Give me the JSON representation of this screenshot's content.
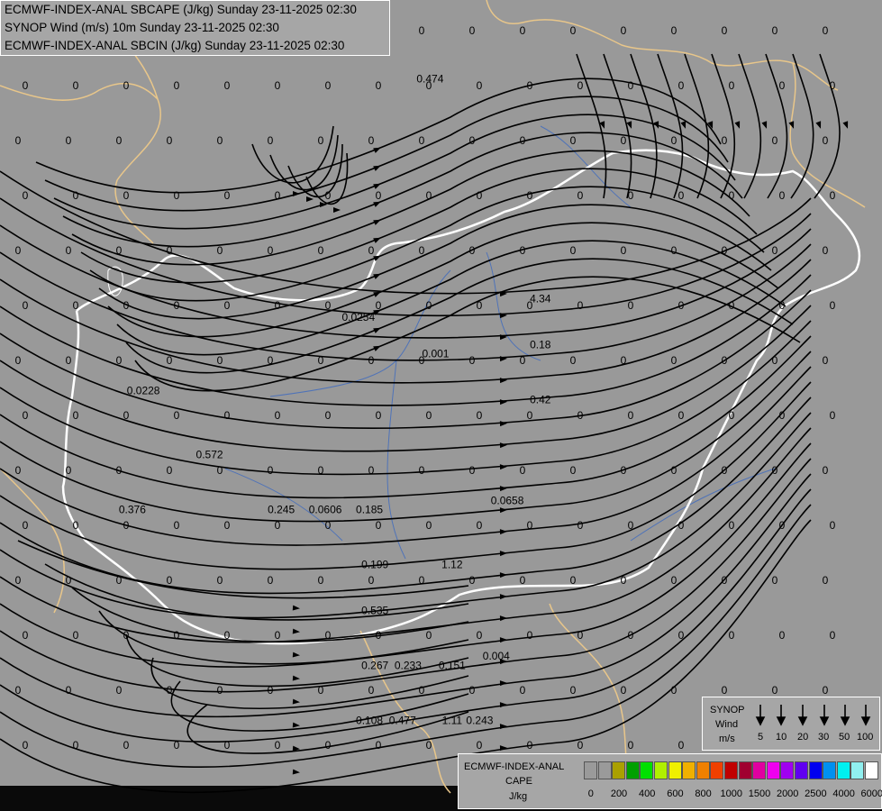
{
  "header": {
    "line1": "ECMWF-INDEX-ANAL SBCAPE (J/kg) Sunday 23-11-2025 02:30",
    "line2": "SYNOP Wind (m/s) 10m Sunday 23-11-2025 02:30",
    "line3": "ECMWF-INDEX-ANAL SBCIN (J/kg) Sunday 23-11-2025 02:30"
  },
  "colors": {
    "background": "#999999",
    "streamline": "#000000",
    "country_border": "#e8c68a",
    "highlight_border": "#ffffff",
    "river": "#4f73b8"
  },
  "value_labels": [
    {
      "text": "0.474",
      "lon": 17.3,
      "lat": 50.0
    },
    {
      "text": "0.0254",
      "lon": 16.0,
      "lat": 47.4
    },
    {
      "text": "0.001",
      "lon": 17.4,
      "lat": 47.0
    },
    {
      "text": "0.0228",
      "lon": 12.1,
      "lat": 46.6
    },
    {
      "text": "0.572",
      "lon": 13.3,
      "lat": 45.9
    },
    {
      "text": "0.376",
      "lon": 11.9,
      "lat": 45.3
    },
    {
      "text": "0.245",
      "lon": 14.6,
      "lat": 45.3
    },
    {
      "text": "0.0606",
      "lon": 15.4,
      "lat": 45.3
    },
    {
      "text": "0.185",
      "lon": 16.2,
      "lat": 45.3
    },
    {
      "text": "0.0658",
      "lon": 18.7,
      "lat": 45.4
    },
    {
      "text": "0.199",
      "lon": 16.3,
      "lat": 44.7
    },
    {
      "text": "1.12",
      "lon": 17.7,
      "lat": 44.7
    },
    {
      "text": "0.535",
      "lon": 16.3,
      "lat": 44.2
    },
    {
      "text": "0.267",
      "lon": 16.3,
      "lat": 43.6
    },
    {
      "text": "0.233",
      "lon": 16.9,
      "lat": 43.6
    },
    {
      "text": "0.151",
      "lon": 17.7,
      "lat": 43.6
    },
    {
      "text": "0.004",
      "lon": 18.5,
      "lat": 43.7
    },
    {
      "text": "0.108",
      "lon": 16.2,
      "lat": 43.0
    },
    {
      "text": "0.477",
      "lon": 16.8,
      "lat": 43.0
    },
    {
      "text": "1.11",
      "lon": 17.7,
      "lat": 43.0
    },
    {
      "text": "0.243",
      "lon": 18.2,
      "lat": 43.0
    },
    {
      "text": "4.34",
      "lon": 19.3,
      "lat": 47.6
    },
    {
      "text": "0.18",
      "lon": 19.3,
      "lat": 47.1
    },
    {
      "text": "0.42",
      "lon": 19.3,
      "lat": 46.5
    }
  ],
  "synop_legend": {
    "title_line1": "SYNOP",
    "title_line2": "Wind",
    "title_line3": "m/s",
    "speeds": [
      "5",
      "10",
      "20",
      "30",
      "50",
      "100"
    ]
  },
  "cape_legend": {
    "title_line1": "ECMWF-INDEX-ANAL",
    "title_line2": "CAPE",
    "title_line3": "J/kg",
    "ticks": [
      "0",
      "200",
      "400",
      "600",
      "800",
      "1000",
      "1500",
      "2000",
      "2500",
      "4000",
      "6000"
    ],
    "colors": [
      "#9a9a9a",
      "#9a9a9a",
      "#aaa000",
      "#00a000",
      "#00e000",
      "#b0f000",
      "#f0f000",
      "#f0b000",
      "#f08000",
      "#f04000",
      "#c00000",
      "#a00030",
      "#e000a0",
      "#f000f0",
      "#a000f0",
      "#6000f0",
      "#0000f0",
      "#0090f0",
      "#00f0f0",
      "#90f0f0",
      "#ffffff"
    ]
  }
}
